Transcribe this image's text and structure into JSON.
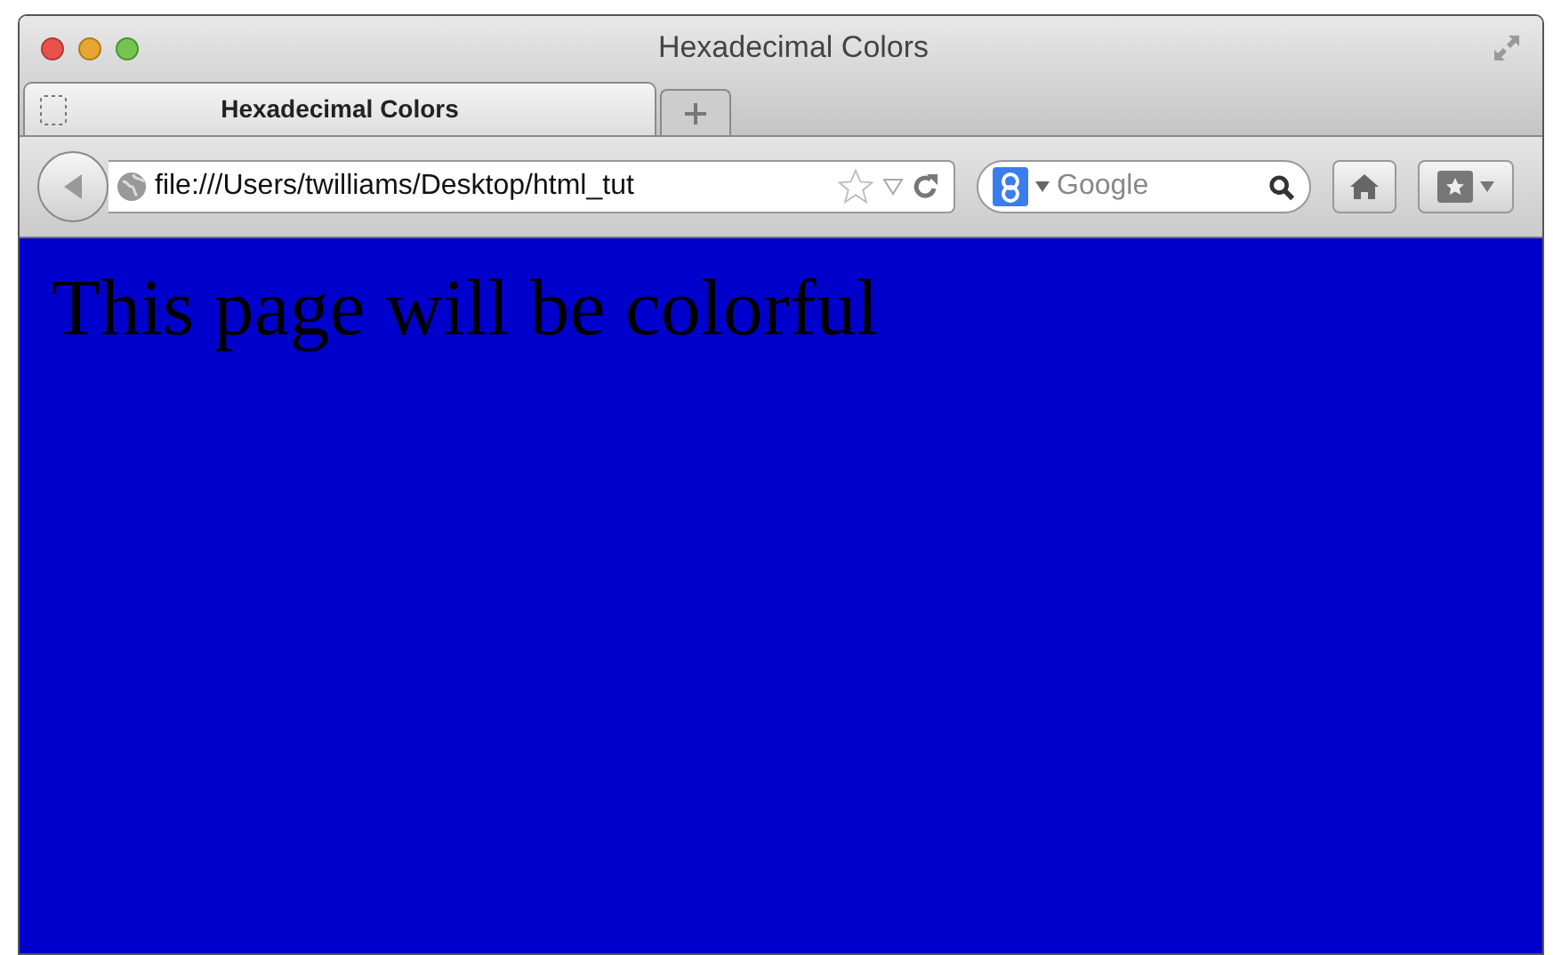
{
  "window": {
    "title": "Hexadecimal Colors"
  },
  "tabs": [
    {
      "label": "Hexadecimal Colors",
      "selected": true
    }
  ],
  "address_bar": {
    "value": "file:///Users/twilliams/Desktop/html_tut"
  },
  "search": {
    "placeholder": "Google"
  },
  "page": {
    "heading": "This page will be colorful"
  }
}
